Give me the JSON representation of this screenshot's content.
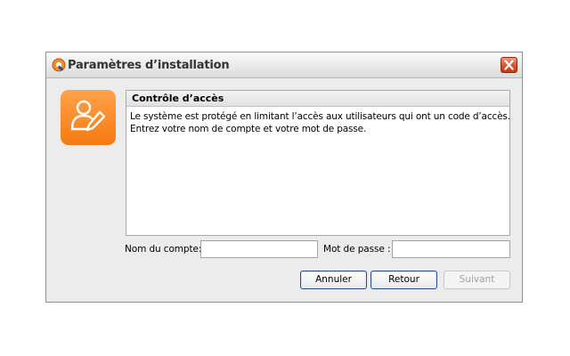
{
  "window": {
    "title": "Paramètres d’installation",
    "app_icon": "setup-logo-icon",
    "close_icon": "close-icon"
  },
  "badge": {
    "icon": "user-edit-icon",
    "color": "#f7871f"
  },
  "panel": {
    "title": "Contrôle d’accès",
    "lines": [
      "Le système est protégé en limitant l’accès aux utilisateurs qui ont un code d’accès.",
      "Entrez votre nom de compte et votre mot de passe."
    ]
  },
  "form": {
    "account_label": "Nom du compte:",
    "account_value": "",
    "password_label": "Mot de passe :",
    "password_value": ""
  },
  "buttons": {
    "cancel": "Annuler",
    "back": "Retour",
    "next": "Suivant"
  }
}
